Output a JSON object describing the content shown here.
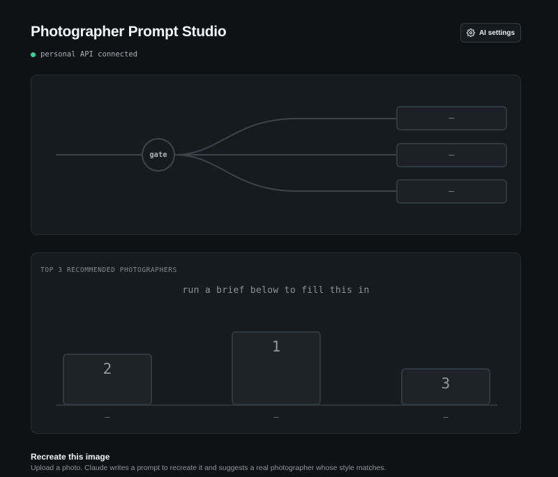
{
  "header": {
    "title": "Photographer Prompt Studio",
    "status_text": "personal API connected",
    "status_color": "#34d399"
  },
  "settings": {
    "label": "AI settings",
    "icon": "gear-icon"
  },
  "flow": {
    "gate_label": "gate",
    "outputs": [
      "—",
      "—",
      "—"
    ]
  },
  "podium": {
    "heading": "TOP 3 RECOMMENDED PHOTOGRAPHERS",
    "hint": "run a brief below to fill this in",
    "places": [
      {
        "rank": "2",
        "name": "—"
      },
      {
        "rank": "1",
        "name": "—"
      },
      {
        "rank": "3",
        "name": "—"
      }
    ]
  },
  "section": {
    "title": "Recreate this image",
    "description": "Upload a photo. Claude writes a prompt to recreate it and suggests a real photographer whose style matches."
  }
}
